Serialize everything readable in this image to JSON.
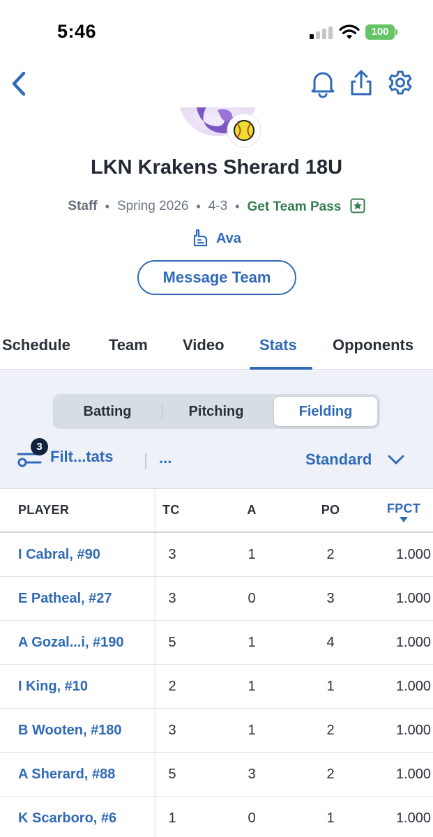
{
  "status_bar": {
    "time": "5:46",
    "battery": "100"
  },
  "team": {
    "name": "LKN Krakens Sherard 18U",
    "role": "Staff",
    "season": "Spring 2026",
    "record": "4-3",
    "pass_label": "Get Team Pass",
    "fan_name": "Ava",
    "message_button": "Message Team"
  },
  "tabs": [
    {
      "label": "Schedule"
    },
    {
      "label": "Team"
    },
    {
      "label": "Video"
    },
    {
      "label": "Stats",
      "active": true
    },
    {
      "label": "Opponents"
    }
  ],
  "segments": [
    {
      "label": "Batting"
    },
    {
      "label": "Pitching"
    },
    {
      "label": "Fielding",
      "active": true
    }
  ],
  "filters": {
    "label": "Filt...tats",
    "count": "3",
    "more": "...",
    "view": "Standard"
  },
  "table": {
    "columns": [
      "PLAYER",
      "TC",
      "A",
      "PO",
      "FPCT"
    ],
    "sort_column": "FPCT",
    "rows": [
      {
        "player": "I Cabral, #90",
        "tc": "3",
        "a": "1",
        "po": "2",
        "fpct": "1.000"
      },
      {
        "player": "E Patheal, #27",
        "tc": "3",
        "a": "0",
        "po": "3",
        "fpct": "1.000"
      },
      {
        "player": "A Gozal...i, #190",
        "tc": "5",
        "a": "1",
        "po": "4",
        "fpct": "1.000"
      },
      {
        "player": "I King, #10",
        "tc": "2",
        "a": "1",
        "po": "1",
        "fpct": "1.000"
      },
      {
        "player": "B Wooten, #180",
        "tc": "3",
        "a": "1",
        "po": "2",
        "fpct": "1.000"
      },
      {
        "player": "A Sherard, #88",
        "tc": "5",
        "a": "3",
        "po": "2",
        "fpct": "1.000"
      },
      {
        "player": "K Scarboro, #6",
        "tc": "1",
        "a": "0",
        "po": "1",
        "fpct": "1.000"
      }
    ]
  },
  "colors": {
    "accent": "#2f6ab7",
    "pass_green": "#2f7d4e",
    "panel_bg": "#eef2f8",
    "badge_bg": "#13233f",
    "battery_green": "#65c466"
  },
  "icons": {
    "back": "chevron-left-icon",
    "notifications": "bell-icon",
    "share": "share-icon",
    "settings": "gear-icon",
    "pass": "star-box-icon",
    "fan": "foam-finger-icon",
    "filter": "filter-slider-icon",
    "view_dropdown": "chevron-down-icon",
    "sort": "sort-down-icon",
    "sport": "softball-icon"
  }
}
